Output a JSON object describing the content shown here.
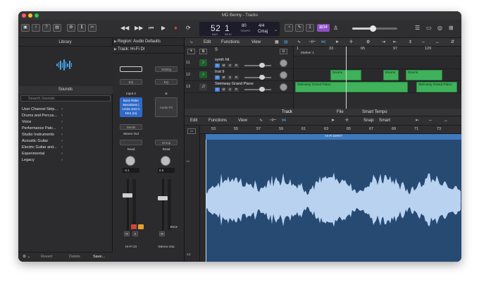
{
  "window": {
    "title": "MD Benny - Tracks"
  },
  "toolbar": {
    "lcd": {
      "bar": "52",
      "beat": "1",
      "bar_label": "BAR",
      "beat_label": "BEAT",
      "tempo": "80",
      "tempo_label": "TEMPO",
      "key": "Cmaj",
      "sig": "4/4"
    },
    "purple_label": "⊞34"
  },
  "library": {
    "title": "Library",
    "sounds_title": "Sounds",
    "search_placeholder": "Search Sounds",
    "items": [
      "User Channel Strip...",
      "Drums and Percus...",
      "Voice",
      "Performance Patc...",
      "Studio Instruments",
      "Acoustic Guitar",
      "Electric Guitar and...",
      "Experimental",
      "Legacy"
    ],
    "footer": {
      "revert": "Revert",
      "delete": "Delete",
      "save": "Save..."
    }
  },
  "inspector": {
    "region_label": "Region: Audio Defaults",
    "track_label": "Track: Hi-Fi DI",
    "strip1": {
      "input": "Input 2",
      "plugin": "Bass Rider MaxxBass | UADx 610-A NS1 (m)",
      "sends": "Sends",
      "output": "Stereo Out",
      "auto": "Read",
      "value": "-3.1",
      "m": "M",
      "s": "S",
      "name": "Hi-Fi DI"
    },
    "strip2": {
      "setting": "Setting",
      "eq": "EQ",
      "slot": "Audio FX",
      "group": "Group",
      "auto": "Read",
      "value": "0.0",
      "bnce": "Bnce",
      "m": "M",
      "name": "Stereo Out"
    }
  },
  "tracks": {
    "menus": {
      "edit": "Edit",
      "functions": "Functions",
      "view": "View"
    },
    "ruler": [
      "1",
      "33",
      "65",
      "97",
      "129"
    ],
    "marker": "Marker 1",
    "rows": [
      {
        "num": "11",
        "name": "synth hit"
      },
      {
        "num": "12",
        "name": "Inst 9"
      },
      {
        "num": "13",
        "name": "Steinway Grand Piano"
      }
    ],
    "regions": {
      "drums1": "Drums",
      "drums2": "Drums",
      "drums3": "Drums",
      "piano1": "Steinway Grand Piano",
      "piano2": "Steinway Grand Piano"
    }
  },
  "editor": {
    "tabs": {
      "track": "Track",
      "file": "File",
      "smart_tempo": "Smart Tempo"
    },
    "menus": {
      "edit": "Edit",
      "functions": "Functions",
      "view": "View",
      "snap_label": "Snap:",
      "snap_value": "Smart"
    },
    "ruler": [
      "53",
      "55",
      "57",
      "59",
      "61",
      "63",
      "65",
      "67",
      "69",
      "71",
      "73"
    ],
    "region_name": "Hi-Fi DI#07",
    "db_labels": [
      "-∞",
      "-12"
    ]
  },
  "colors": {
    "accent_blue": "#3f79bf",
    "region_green": "#3fb25b",
    "purple": "#8d4fc3",
    "record_red": "#e04a3c"
  }
}
